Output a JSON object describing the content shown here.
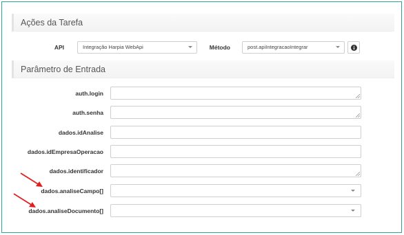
{
  "sections": {
    "tarefa_title": "Ações da Tarefa",
    "entrada_title": "Parâmetro de Entrada"
  },
  "api": {
    "label": "API",
    "value": "Integração Harpia WebApi"
  },
  "metodo": {
    "label": "Método",
    "value": "post.apiIntegracaoIntegrar"
  },
  "params": [
    {
      "label": "auth.login"
    },
    {
      "label": "auth.senha"
    },
    {
      "label": "dados.idAnalise"
    },
    {
      "label": "dados.idEmpresaOperacao"
    },
    {
      "label": "dados.identificador"
    },
    {
      "label": "dados.analiseCampo[]"
    },
    {
      "label": "dados.analiseDocumento[]"
    }
  ],
  "colors": {
    "frame_border": "#2aa39b",
    "arrow": "#e02020"
  },
  "icons": {
    "info": "info-circle-icon",
    "dropdown": "caret-down-icon",
    "resize": "resize-grip-icon",
    "annotation": "red-arrow-icon"
  }
}
